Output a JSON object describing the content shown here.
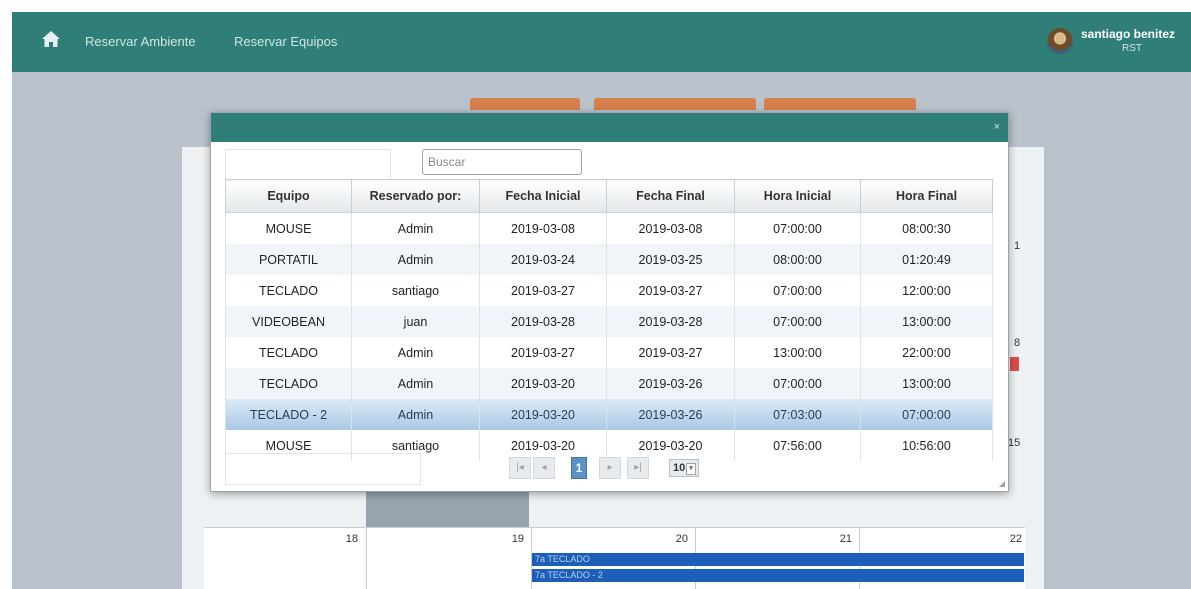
{
  "nav": {
    "links": [
      "Reservar Ambiente",
      "Reservar Equipos"
    ],
    "user_name": "santiago benitez",
    "user_role": "RST"
  },
  "modal": {
    "close_label": "×",
    "search_placeholder": "Buscar",
    "columns": [
      "Equipo",
      "Reservado por:",
      "Fecha Inicial",
      "Fecha Final",
      "Hora Inicial",
      "Hora Final"
    ],
    "rows": [
      [
        "MOUSE",
        "Admin",
        "2019-03-08",
        "2019-03-08",
        "07:00:00",
        "08:00:30"
      ],
      [
        "PORTATIL",
        "Admin",
        "2019-03-24",
        "2019-03-25",
        "08:00:00",
        "01:20:49"
      ],
      [
        "TECLADO",
        "santiago",
        "2019-03-27",
        "2019-03-27",
        "07:00:00",
        "12:00:00"
      ],
      [
        "VIDEOBEAN",
        "juan",
        "2019-03-28",
        "2019-03-28",
        "07:00:00",
        "13:00:00"
      ],
      [
        "TECLADO",
        "Admin",
        "2019-03-27",
        "2019-03-27",
        "13:00:00",
        "22:00:00"
      ],
      [
        "TECLADO",
        "Admin",
        "2019-03-20",
        "2019-03-26",
        "07:00:00",
        "13:00:00"
      ],
      [
        "TECLADO - 2",
        "Admin",
        "2019-03-20",
        "2019-03-26",
        "07:03:00",
        "07:00:00"
      ],
      [
        "MOUSE",
        "santiago",
        "2019-03-20",
        "2019-03-20",
        "07:56:00",
        "10:56:00"
      ]
    ],
    "selected_row": 6,
    "pager": {
      "first": "|◂",
      "prev": "◂",
      "current_page": "1",
      "next": "▸",
      "last": "▸|",
      "page_size": "10"
    }
  },
  "calendar": {
    "day_numbers": [
      "18",
      "19",
      "20",
      "21",
      "22"
    ],
    "side_numbers": [
      "1",
      "8",
      "15"
    ],
    "events": [
      "7a TECLADO",
      "7a TECLADO - 2"
    ]
  },
  "colors": {
    "navbar": "#2f7f78",
    "accent_button": "#d77f4c",
    "event": "#1d5fb8",
    "selected_row": "#a9c9e4"
  }
}
